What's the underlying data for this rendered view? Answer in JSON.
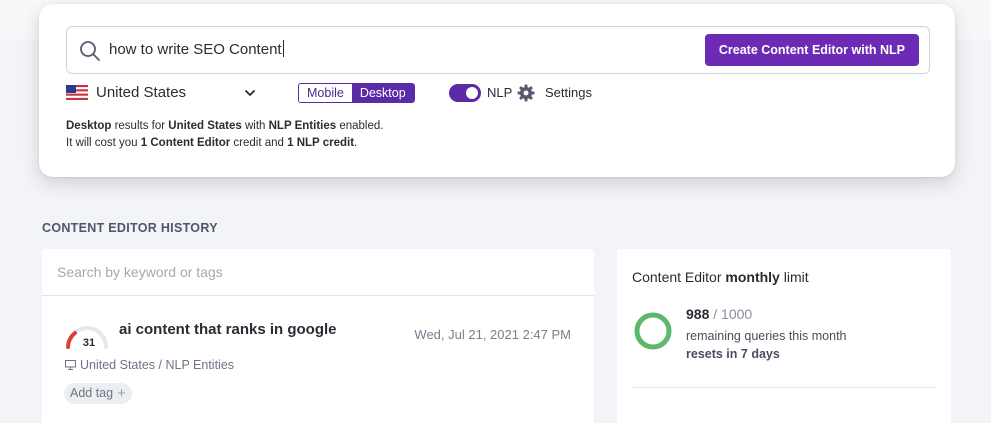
{
  "search": {
    "query": "how to write SEO Content",
    "create_button_label": "Create Content Editor with NLP"
  },
  "options": {
    "country": "United States",
    "device_options": [
      "Mobile",
      "Desktop"
    ],
    "active_device": "Desktop",
    "nlp_label": "NLP",
    "nlp_enabled": true,
    "settings_label": "Settings"
  },
  "summary": {
    "line1_device": "Desktop",
    "line1_mid1": " results for ",
    "line1_country": "United States",
    "line1_mid2": " with ",
    "line1_nlp": "NLP Entities",
    "line1_end": " enabled.",
    "line2_start": "It will cost you ",
    "line2_ce": "1 Content Editor",
    "line2_mid": " credit and ",
    "line2_nlp": "1 NLP credit",
    "line2_end": "."
  },
  "history": {
    "heading": "CONTENT EDITOR HISTORY",
    "search_placeholder": "Search by keyword or tags",
    "items": [
      {
        "score": "31",
        "title": "ai content that ranks in google",
        "date": "Wed, Jul 21, 2021 2:47 PM",
        "meta": "United States / NLP Entities",
        "add_tag_label": "Add tag"
      }
    ]
  },
  "limit": {
    "title_start": "Content Editor ",
    "title_bold": "monthly",
    "title_end": " limit",
    "remaining": "988",
    "total": " / 1000",
    "remaining_label": "remaining queries this month",
    "resets_label": "resets in 7 days"
  },
  "colors": {
    "accent": "#6c2bb4",
    "ring": "#5cb86a",
    "gauge": "#d9413a"
  }
}
